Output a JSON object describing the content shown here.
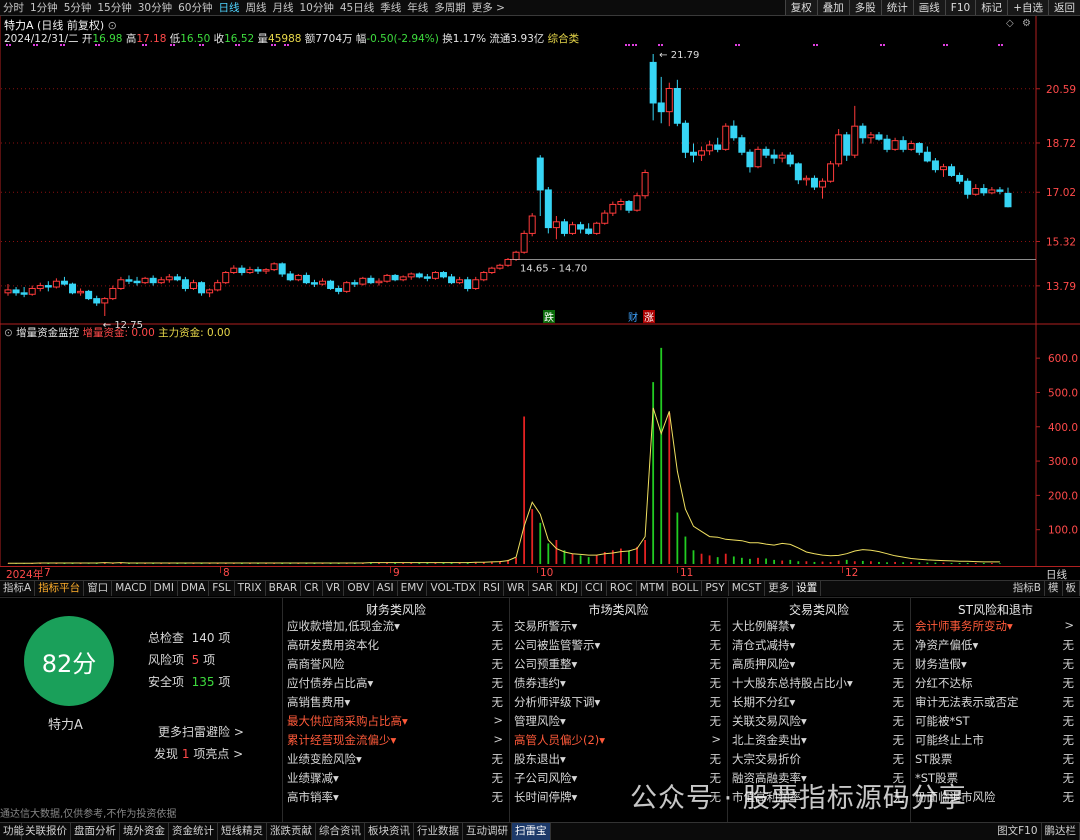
{
  "periods": [
    "分时",
    "1分钟",
    "5分钟",
    "15分钟",
    "30分钟",
    "60分钟",
    "日线",
    "周线",
    "月线",
    "10分钟",
    "45日线",
    "季线",
    "年线",
    "多周期",
    "更多 >"
  ],
  "active_period": "日线",
  "right_menu": [
    "复权",
    "叠加",
    "多股",
    "统计",
    "画线",
    "F10",
    "标记",
    "+自选",
    "返回"
  ],
  "stock": {
    "name": "特力A",
    "mode": "(日线 前复权)",
    "date": "2024/12/31/二",
    "open": "16.98",
    "high": "17.18",
    "low": "16.50",
    "close": "16.52",
    "vol": "45988",
    "amount": "7704万",
    "change": "-0.50(-2.94%)",
    "turnover": "1.17%",
    "float_cap": "3.93亿",
    "category": "综合类"
  },
  "labels": {
    "open": "开",
    "high": "高",
    "low": "低",
    "close": "收",
    "vol": "量",
    "amount": "额",
    "change": "幅",
    "turnover": "换",
    "float_cap": "流通"
  },
  "annotations": {
    "high": "21.79",
    "low": "12.75",
    "range": "14.65 - 14.70"
  },
  "flags": {
    "die": "跌",
    "cai": "财",
    "zhang": "涨"
  },
  "price_axis": [
    "20.59",
    "18.72",
    "17.02",
    "15.32",
    "13.79"
  ],
  "vol_axis": [
    "600.0",
    "500.0",
    "400.0",
    "300.0",
    "200.0",
    "100.0"
  ],
  "vol_indicator": {
    "name": "增量资金监控",
    "inc_label": "增量资金",
    "inc_value": "0.00",
    "main_label": "主力资金",
    "main_value": "0.00"
  },
  "months": [
    "2024年",
    "7",
    "8",
    "9",
    "10",
    "11",
    "12"
  ],
  "axis_right": "日线",
  "indicators": [
    "指标A",
    "指标平台",
    "窗口",
    "MACD",
    "DMI",
    "DMA",
    "FSL",
    "TRIX",
    "BRAR",
    "CR",
    "VR",
    "OBV",
    "ASI",
    "EMV",
    "VOL-TDX",
    "RSI",
    "WR",
    "SAR",
    "KDJ",
    "CCI",
    "ROC",
    "MTM",
    "BOLL",
    "PSY",
    "MCST",
    "更多",
    "设置"
  ],
  "indicators_right": [
    "指标B",
    "模",
    "板"
  ],
  "risk": {
    "score": "82分",
    "name": "特力A",
    "total_label": "总检查",
    "total": "140",
    "total_unit": "项",
    "risk_label": "风险项",
    "risk_count": "5",
    "risk_unit": "项",
    "safe_label": "安全项",
    "safe_count": "135",
    "safe_unit": "项",
    "more": "更多扫雷避险 >",
    "found_pre": "发现",
    "found_count": "1",
    "found_post": "项亮点 >",
    "columns": [
      {
        "title": "财务类风险",
        "rows": [
          {
            "k": "应收款增加,低现金流▾",
            "v": "无"
          },
          {
            "k": "高研发费用资本化",
            "v": "无"
          },
          {
            "k": "高商誉风险",
            "v": "无"
          },
          {
            "k": "应付债券占比高▾",
            "v": "无"
          },
          {
            "k": "高销售费用▾",
            "v": "无"
          },
          {
            "k": "最大供应商采购占比高▾",
            "v": ">",
            "hot": true
          },
          {
            "k": "累计经营现金流偏少▾",
            "v": ">",
            "hot": true
          },
          {
            "k": "业绩变脸风险▾",
            "v": "无"
          },
          {
            "k": "业绩骤减▾",
            "v": "无"
          },
          {
            "k": "高市销率▾",
            "v": "无"
          }
        ]
      },
      {
        "title": "市场类风险",
        "rows": [
          {
            "k": "交易所警示▾",
            "v": "无"
          },
          {
            "k": "公司被监管警示▾",
            "v": "无"
          },
          {
            "k": "公司预重整▾",
            "v": "无"
          },
          {
            "k": "债券违约▾",
            "v": "无"
          },
          {
            "k": "分析师评级下调▾",
            "v": "无"
          },
          {
            "k": "管理风险▾",
            "v": "无"
          },
          {
            "k": "高管人员偏少(2)▾",
            "v": ">",
            "hot": true
          },
          {
            "k": "股东退出▾",
            "v": "无"
          },
          {
            "k": "子公司风险▾",
            "v": "无"
          },
          {
            "k": "长时间停牌▾",
            "v": "无"
          }
        ]
      },
      {
        "title": "交易类风险",
        "rows": [
          {
            "k": "大比例解禁▾",
            "v": "无"
          },
          {
            "k": "清仓式减持▾",
            "v": "无"
          },
          {
            "k": "高质押风险▾",
            "v": "无"
          },
          {
            "k": "十大股东总持股占比小▾",
            "v": "无"
          },
          {
            "k": "长期不分红▾",
            "v": "无"
          },
          {
            "k": "关联交易风险▾",
            "v": "无"
          },
          {
            "k": "北上资金卖出▾",
            "v": "无"
          },
          {
            "k": "大宗交易折价",
            "v": "无"
          },
          {
            "k": "融资高融卖率▾",
            "v": "无"
          },
          {
            "k": "市值高利润率",
            "v": "无"
          }
        ]
      },
      {
        "title": "ST风险和退市",
        "rows": [
          {
            "k": "会计师事务所变动▾",
            "v": ">",
            "hot": true
          },
          {
            "k": "净资产偏低▾",
            "v": "无"
          },
          {
            "k": "财务造假▾",
            "v": "无"
          },
          {
            "k": "分红不达标",
            "v": "无"
          },
          {
            "k": "审计无法表示或否定",
            "v": "无"
          },
          {
            "k": "可能被*ST",
            "v": "无"
          },
          {
            "k": "可能终止上市",
            "v": "无"
          },
          {
            "k": "ST股票",
            "v": "无"
          },
          {
            "k": "*ST股票",
            "v": "无"
          },
          {
            "k": "仍面临退市风险",
            "v": "无"
          }
        ]
      }
    ]
  },
  "bottom": [
    "功能",
    "关联报价",
    "盘面分析",
    "境外资金",
    "资金统计",
    "短线精灵",
    "涨跌贡献",
    "综合资讯",
    "板块资讯",
    "行业数据",
    "互动调研",
    "扫雷宝"
  ],
  "bottom_active": "扫雷宝",
  "bottom_right": [
    "图文F10",
    "鹏达栏"
  ],
  "disclaimer": "通达信大数据,仅供参考,不作为投资依据",
  "watermark": "公众号 · 股票指标源码分享",
  "colors": {
    "up": "#ff3b3b",
    "down": "#37d5f5",
    "accent": "#4fd4ff",
    "score_bg": "#1aa05a"
  },
  "chart_data": {
    "type": "candlestick",
    "price": [
      [
        13.55,
        13.85,
        13.45,
        13.65
      ],
      [
        13.65,
        13.75,
        13.45,
        13.55
      ],
      [
        13.55,
        13.75,
        13.4,
        13.5
      ],
      [
        13.5,
        13.8,
        13.45,
        13.7
      ],
      [
        13.7,
        13.9,
        13.6,
        13.8
      ],
      [
        13.8,
        13.95,
        13.6,
        13.75
      ],
      [
        13.75,
        14.05,
        13.7,
        13.95
      ],
      [
        13.95,
        14.1,
        13.8,
        13.85
      ],
      [
        13.85,
        13.9,
        13.5,
        13.55
      ],
      [
        13.55,
        13.7,
        13.45,
        13.6
      ],
      [
        13.6,
        13.65,
        13.3,
        13.35
      ],
      [
        13.35,
        13.45,
        13.1,
        13.2
      ],
      [
        13.2,
        13.4,
        12.75,
        13.35
      ],
      [
        13.35,
        13.8,
        13.3,
        13.7
      ],
      [
        13.7,
        14.1,
        13.65,
        14.0
      ],
      [
        14.0,
        14.15,
        13.85,
        13.95
      ],
      [
        13.95,
        14.1,
        13.8,
        13.9
      ],
      [
        13.9,
        14.1,
        13.85,
        14.05
      ],
      [
        14.05,
        14.15,
        13.8,
        13.9
      ],
      [
        13.9,
        14.1,
        13.85,
        14.0
      ],
      [
        14.0,
        14.2,
        13.9,
        14.1
      ],
      [
        14.1,
        14.2,
        13.95,
        14.0
      ],
      [
        14.0,
        14.1,
        13.6,
        13.7
      ],
      [
        13.7,
        14.0,
        13.65,
        13.9
      ],
      [
        13.9,
        13.95,
        13.45,
        13.55
      ],
      [
        13.55,
        13.7,
        13.4,
        13.65
      ],
      [
        13.65,
        14.0,
        13.6,
        13.9
      ],
      [
        13.9,
        14.3,
        13.85,
        14.25
      ],
      [
        14.25,
        14.5,
        14.2,
        14.4
      ],
      [
        14.4,
        14.5,
        14.15,
        14.25
      ],
      [
        14.25,
        14.45,
        14.2,
        14.35
      ],
      [
        14.35,
        14.45,
        14.2,
        14.3
      ],
      [
        14.3,
        14.4,
        14.2,
        14.35
      ],
      [
        14.35,
        14.6,
        14.3,
        14.55
      ],
      [
        14.55,
        14.6,
        14.1,
        14.2
      ],
      [
        14.2,
        14.3,
        13.95,
        14.0
      ],
      [
        14.0,
        14.2,
        13.95,
        14.15
      ],
      [
        14.15,
        14.25,
        13.85,
        13.9
      ],
      [
        13.9,
        14.0,
        13.75,
        13.85
      ],
      [
        13.85,
        14.05,
        13.8,
        13.95
      ],
      [
        13.95,
        14.0,
        13.65,
        13.7
      ],
      [
        13.7,
        13.8,
        13.5,
        13.6
      ],
      [
        13.6,
        13.95,
        13.55,
        13.9
      ],
      [
        13.9,
        14.0,
        13.75,
        13.85
      ],
      [
        13.85,
        14.1,
        13.8,
        14.05
      ],
      [
        14.05,
        14.15,
        13.85,
        13.9
      ],
      [
        13.9,
        14.05,
        13.8,
        13.95
      ],
      [
        13.95,
        14.2,
        13.9,
        14.15
      ],
      [
        14.15,
        14.2,
        13.95,
        14.0
      ],
      [
        14.0,
        14.15,
        13.95,
        14.1
      ],
      [
        14.1,
        14.25,
        14.0,
        14.2
      ],
      [
        14.2,
        14.25,
        14.05,
        14.1
      ],
      [
        14.1,
        14.2,
        13.95,
        14.05
      ],
      [
        14.05,
        14.3,
        14.0,
        14.25
      ],
      [
        14.25,
        14.3,
        14.05,
        14.1
      ],
      [
        14.1,
        14.2,
        13.85,
        13.9
      ],
      [
        13.9,
        14.1,
        13.85,
        14.0
      ],
      [
        14.0,
        14.1,
        13.6,
        13.7
      ],
      [
        13.7,
        14.1,
        13.65,
        14.0
      ],
      [
        14.0,
        14.3,
        13.95,
        14.25
      ],
      [
        14.25,
        14.45,
        14.2,
        14.4
      ],
      [
        14.4,
        14.55,
        14.35,
        14.5
      ],
      [
        14.5,
        14.75,
        14.45,
        14.7
      ],
      [
        14.7,
        15.0,
        14.65,
        14.95
      ],
      [
        14.95,
        15.7,
        14.9,
        15.6
      ],
      [
        15.6,
        16.3,
        15.5,
        16.2
      ],
      [
        18.2,
        18.3,
        16.2,
        17.1
      ],
      [
        17.1,
        17.2,
        15.6,
        15.8
      ],
      [
        15.8,
        16.2,
        15.4,
        16.0
      ],
      [
        16.0,
        16.1,
        15.5,
        15.6
      ],
      [
        15.6,
        16.0,
        15.55,
        15.9
      ],
      [
        15.9,
        16.0,
        15.6,
        15.75
      ],
      [
        15.75,
        15.95,
        15.55,
        15.6
      ],
      [
        15.6,
        16.0,
        15.55,
        15.95
      ],
      [
        15.95,
        16.4,
        15.9,
        16.3
      ],
      [
        16.3,
        16.7,
        16.2,
        16.6
      ],
      [
        16.6,
        16.8,
        16.4,
        16.7
      ],
      [
        16.7,
        16.75,
        16.3,
        16.4
      ],
      [
        16.4,
        17.0,
        16.35,
        16.9
      ],
      [
        16.9,
        17.8,
        16.8,
        17.7
      ],
      [
        21.5,
        21.79,
        19.5,
        20.1
      ],
      [
        20.1,
        21.0,
        19.4,
        19.8
      ],
      [
        19.8,
        20.8,
        19.3,
        20.6
      ],
      [
        20.6,
        20.9,
        19.3,
        19.4
      ],
      [
        19.4,
        19.5,
        18.2,
        18.4
      ],
      [
        18.4,
        18.7,
        18.05,
        18.3
      ],
      [
        18.3,
        18.6,
        18.1,
        18.45
      ],
      [
        18.45,
        18.8,
        18.3,
        18.65
      ],
      [
        18.65,
        18.9,
        18.4,
        18.5
      ],
      [
        18.5,
        19.4,
        18.45,
        19.3
      ],
      [
        19.3,
        19.5,
        18.8,
        18.9
      ],
      [
        18.9,
        19.0,
        18.3,
        18.4
      ],
      [
        18.4,
        18.5,
        17.7,
        17.9
      ],
      [
        17.9,
        18.6,
        17.85,
        18.5
      ],
      [
        18.5,
        18.6,
        18.2,
        18.3
      ],
      [
        18.3,
        18.5,
        18.0,
        18.2
      ],
      [
        18.2,
        18.4,
        18.05,
        18.3
      ],
      [
        18.3,
        18.4,
        17.9,
        18.0
      ],
      [
        18.0,
        18.05,
        17.3,
        17.45
      ],
      [
        17.45,
        17.6,
        17.25,
        17.5
      ],
      [
        17.5,
        17.6,
        17.1,
        17.2
      ],
      [
        17.2,
        17.5,
        16.8,
        17.4
      ],
      [
        17.4,
        18.1,
        17.35,
        18.0
      ],
      [
        18.0,
        19.2,
        17.9,
        19.0
      ],
      [
        19.0,
        19.1,
        18.1,
        18.3
      ],
      [
        18.3,
        20.0,
        18.2,
        19.3
      ],
      [
        19.3,
        19.4,
        18.7,
        18.9
      ],
      [
        18.9,
        19.1,
        18.7,
        19.0
      ],
      [
        19.0,
        19.1,
        18.8,
        18.85
      ],
      [
        18.85,
        19.0,
        18.4,
        18.5
      ],
      [
        18.5,
        18.9,
        18.45,
        18.8
      ],
      [
        18.8,
        18.95,
        18.4,
        18.5
      ],
      [
        18.5,
        18.8,
        18.45,
        18.7
      ],
      [
        18.7,
        18.75,
        18.3,
        18.4
      ],
      [
        18.4,
        18.6,
        18.05,
        18.1
      ],
      [
        18.1,
        18.2,
        17.7,
        17.8
      ],
      [
        17.8,
        18.0,
        17.55,
        17.9
      ],
      [
        17.9,
        18.0,
        17.55,
        17.6
      ],
      [
        17.6,
        17.7,
        17.3,
        17.4
      ],
      [
        17.4,
        17.5,
        16.8,
        16.95
      ],
      [
        16.95,
        17.3,
        16.9,
        17.15
      ],
      [
        17.15,
        17.3,
        16.9,
        17.0
      ],
      [
        17.0,
        17.2,
        16.95,
        17.1
      ],
      [
        17.1,
        17.2,
        16.95,
        17.05
      ],
      [
        16.98,
        17.18,
        16.5,
        16.52
      ]
    ],
    "vol": [
      1,
      1,
      1,
      2,
      2,
      2,
      3,
      2,
      2,
      3,
      1,
      2,
      4,
      2,
      3,
      2,
      2,
      3,
      2,
      2,
      2,
      3,
      2,
      3,
      2,
      2,
      3,
      2,
      3,
      2,
      2,
      2,
      3,
      2,
      2,
      3,
      2,
      2,
      3,
      2,
      2,
      3,
      2,
      3,
      3,
      4,
      3,
      4,
      3,
      3,
      4,
      4,
      3,
      4,
      3,
      5,
      3,
      4,
      4,
      5,
      6,
      8,
      12,
      18,
      430,
      160,
      120,
      60,
      70,
      40,
      30,
      25,
      20,
      25,
      35,
      40,
      45,
      40,
      50,
      70,
      530,
      630,
      440,
      150,
      80,
      40,
      30,
      25,
      20,
      30,
      22,
      18,
      15,
      18,
      16,
      12,
      10,
      12,
      8,
      8,
      6,
      7,
      6,
      10,
      12,
      8,
      9,
      8,
      6,
      5,
      6,
      5,
      6,
      5,
      4,
      4,
      4,
      3,
      3,
      3,
      3,
      3,
      3,
      2
    ],
    "flow": [
      2,
      2,
      2,
      2,
      3,
      3,
      3,
      3,
      3,
      3,
      3,
      3,
      4,
      3,
      4,
      3,
      3,
      3,
      3,
      3,
      3,
      3,
      3,
      3,
      3,
      3,
      3,
      3,
      3,
      3,
      3,
      3,
      3,
      3,
      3,
      3,
      3,
      3,
      3,
      3,
      3,
      3,
      3,
      3,
      3,
      4,
      4,
      4,
      4,
      4,
      4,
      4,
      4,
      4,
      4,
      4,
      4,
      4,
      5,
      5,
      6,
      7,
      10,
      20,
      110,
      180,
      145,
      70,
      45,
      35,
      30,
      28,
      26,
      26,
      30,
      32,
      36,
      38,
      45,
      80,
      455,
      380,
      445,
      270,
      160,
      110,
      95,
      80,
      78,
      72,
      70,
      68,
      62,
      62,
      58,
      55,
      60,
      57,
      47,
      35,
      30,
      26,
      24,
      25,
      30,
      38,
      42,
      40,
      36,
      30,
      24,
      20,
      16,
      14,
      12,
      11,
      10,
      9,
      8,
      8,
      7,
      6,
      6,
      6
    ]
  }
}
